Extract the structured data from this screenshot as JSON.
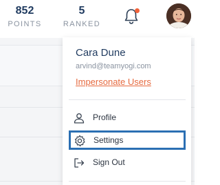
{
  "stats": {
    "points": {
      "value": "852",
      "label": "POINTS"
    },
    "ranked": {
      "value": "5",
      "label": "RANKED"
    }
  },
  "notifications": {
    "icon": "bell-icon",
    "badge_color": "#f0623a"
  },
  "user": {
    "avatar": "avatar",
    "name": "Cara Dune",
    "email": "arvind@teamyogi.com",
    "impersonate_label": "Impersonate Users"
  },
  "menu": {
    "items": [
      {
        "label": "Profile",
        "icon": "person-icon"
      },
      {
        "label": "Settings",
        "icon": "gear-icon",
        "selected": true
      },
      {
        "label": "Sign Out",
        "icon": "sign-out-icon"
      }
    ]
  },
  "colors": {
    "accent": "#e66a3f",
    "primary": "#1f3a5f",
    "focus": "#2b6fb3"
  }
}
